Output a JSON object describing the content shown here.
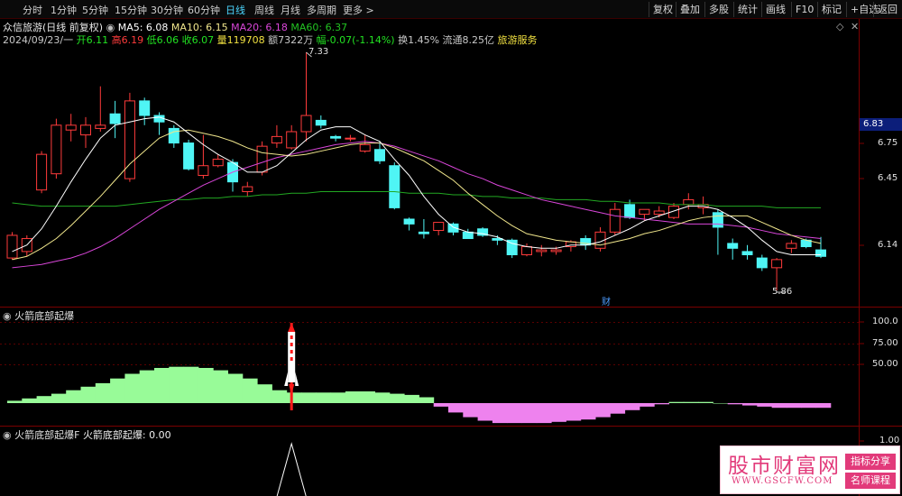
{
  "toolbar": {
    "tabs": [
      "分时",
      "1分钟",
      "5分钟",
      "15分钟",
      "30分钟",
      "60分钟",
      "日线",
      "周线",
      "月线",
      "多周期",
      "更多 >"
    ],
    "active_tab": "日线",
    "right_buttons": [
      "复权",
      "叠加",
      "多股",
      "统计",
      "画线",
      "F10",
      "标记",
      "+自选",
      "返回"
    ]
  },
  "header": {
    "stock_name": "众信旅游(日线 前复权)",
    "ma5": "MA5: 6.08",
    "ma10": "MA10: 6.15",
    "ma20": "MA20: 6.18",
    "ma60": "MA60: 6.37",
    "date": "2024/09/23/一",
    "open": "开6.11",
    "high": "高6.19",
    "low": "低6.06",
    "close": "收6.07",
    "volume": "量119708",
    "amount": "额7322万",
    "change": "幅-0.07(-1.14%)",
    "turnover": "换1.45%",
    "float_cap": "流通8.25亿",
    "sector": "旅游服务"
  },
  "price_axis": {
    "labels": [
      "6.75",
      "6.45",
      "6.14"
    ],
    "current_price": "6.83",
    "max_label": "7.33",
    "min_label": "5.86",
    "event_marker": "财"
  },
  "indicator1": {
    "title": "火箭底部起爆",
    "axis": [
      "100.0",
      "75.00",
      "50.00"
    ]
  },
  "indicator2": {
    "title": "火箭底部起爆F",
    "value_text": "火箭底部起爆: 0.00",
    "axis": [
      "1.00"
    ]
  },
  "watermark": {
    "title": "股市财富网",
    "url": "WWW.GSCFW.COM",
    "badge1": "指标分享",
    "badge2": "名师课程"
  },
  "colors": {
    "up": "#ff3b3b",
    "down": "#4ff5f5",
    "ma5": "#ffffff",
    "ma10": "#f0e68c",
    "ma20": "#d946d9",
    "ma60": "#22a822",
    "pos_area": "#98fb98",
    "neg_area": "#ee82ee"
  },
  "chart_data": {
    "type": "candlestick",
    "price_range": [
      5.86,
      7.33
    ],
    "candles": [
      {
        "o": 6.06,
        "h": 6.22,
        "l": 6.05,
        "c": 6.2
      },
      {
        "o": 6.1,
        "h": 6.2,
        "l": 6.07,
        "c": 6.18
      },
      {
        "o": 6.48,
        "h": 6.72,
        "l": 6.46,
        "c": 6.7
      },
      {
        "o": 6.58,
        "h": 6.92,
        "l": 6.55,
        "c": 6.88
      },
      {
        "o": 6.85,
        "h": 6.95,
        "l": 6.78,
        "c": 6.88
      },
      {
        "o": 6.82,
        "h": 6.93,
        "l": 6.74,
        "c": 6.88
      },
      {
        "o": 6.86,
        "h": 7.12,
        "l": 6.84,
        "c": 6.88
      },
      {
        "o": 6.95,
        "h": 7.03,
        "l": 6.8,
        "c": 6.89
      },
      {
        "o": 6.55,
        "h": 7.08,
        "l": 6.53,
        "c": 7.03
      },
      {
        "o": 7.03,
        "h": 7.05,
        "l": 6.88,
        "c": 6.94
      },
      {
        "o": 6.94,
        "h": 6.96,
        "l": 6.82,
        "c": 6.9
      },
      {
        "o": 6.86,
        "h": 6.88,
        "l": 6.74,
        "c": 6.77
      },
      {
        "o": 6.77,
        "h": 6.79,
        "l": 6.6,
        "c": 6.61
      },
      {
        "o": 6.57,
        "h": 6.82,
        "l": 6.55,
        "c": 6.63
      },
      {
        "o": 6.63,
        "h": 6.7,
        "l": 6.62,
        "c": 6.67
      },
      {
        "o": 6.65,
        "h": 6.67,
        "l": 6.47,
        "c": 6.53
      },
      {
        "o": 6.47,
        "h": 6.53,
        "l": 6.44,
        "c": 6.5
      },
      {
        "o": 6.59,
        "h": 6.78,
        "l": 6.57,
        "c": 6.75
      },
      {
        "o": 6.77,
        "h": 6.88,
        "l": 6.74,
        "c": 6.81
      },
      {
        "o": 6.74,
        "h": 6.88,
        "l": 6.73,
        "c": 6.84
      },
      {
        "o": 6.84,
        "h": 7.33,
        "l": 6.78,
        "c": 6.94
      },
      {
        "o": 6.91,
        "h": 6.94,
        "l": 6.86,
        "c": 6.88
      },
      {
        "o": 6.81,
        "h": 6.82,
        "l": 6.78,
        "c": 6.8
      },
      {
        "o": 6.8,
        "h": 6.82,
        "l": 6.78,
        "c": 6.8
      },
      {
        "o": 6.72,
        "h": 6.82,
        "l": 6.71,
        "c": 6.76
      },
      {
        "o": 6.73,
        "h": 6.78,
        "l": 6.64,
        "c": 6.66
      },
      {
        "o": 6.63,
        "h": 6.65,
        "l": 6.36,
        "c": 6.37
      },
      {
        "o": 6.3,
        "h": 6.31,
        "l": 6.23,
        "c": 6.27
      },
      {
        "o": 6.22,
        "h": 6.3,
        "l": 6.18,
        "c": 6.21
      },
      {
        "o": 6.23,
        "h": 6.28,
        "l": 6.2,
        "c": 6.28
      },
      {
        "o": 6.27,
        "h": 6.28,
        "l": 6.2,
        "c": 6.22
      },
      {
        "o": 6.22,
        "h": 6.24,
        "l": 6.18,
        "c": 6.18
      },
      {
        "o": 6.24,
        "h": 6.25,
        "l": 6.19,
        "c": 6.2
      },
      {
        "o": 6.18,
        "h": 6.2,
        "l": 6.14,
        "c": 6.17
      },
      {
        "o": 6.17,
        "h": 6.18,
        "l": 6.06,
        "c": 6.08
      },
      {
        "o": 6.08,
        "h": 6.15,
        "l": 6.07,
        "c": 6.13
      },
      {
        "o": 6.1,
        "h": 6.14,
        "l": 6.07,
        "c": 6.11
      },
      {
        "o": 6.1,
        "h": 6.13,
        "l": 6.08,
        "c": 6.11
      },
      {
        "o": 6.13,
        "h": 6.17,
        "l": 6.1,
        "c": 6.16
      },
      {
        "o": 6.18,
        "h": 6.2,
        "l": 6.11,
        "c": 6.14
      },
      {
        "o": 6.12,
        "h": 6.25,
        "l": 6.1,
        "c": 6.22
      },
      {
        "o": 6.22,
        "h": 6.4,
        "l": 6.2,
        "c": 6.36
      },
      {
        "o": 6.39,
        "h": 6.42,
        "l": 6.3,
        "c": 6.31
      },
      {
        "o": 6.33,
        "h": 6.36,
        "l": 6.29,
        "c": 6.36
      },
      {
        "o": 6.33,
        "h": 6.38,
        "l": 6.31,
        "c": 6.35
      },
      {
        "o": 6.31,
        "h": 6.4,
        "l": 6.3,
        "c": 6.38
      },
      {
        "o": 6.39,
        "h": 6.46,
        "l": 6.36,
        "c": 6.42
      },
      {
        "o": 6.37,
        "h": 6.44,
        "l": 6.33,
        "c": 6.39
      },
      {
        "o": 6.34,
        "h": 6.36,
        "l": 6.08,
        "c": 6.25
      },
      {
        "o": 6.15,
        "h": 6.18,
        "l": 6.05,
        "c": 6.12
      },
      {
        "o": 6.1,
        "h": 6.14,
        "l": 6.05,
        "c": 6.08
      },
      {
        "o": 6.06,
        "h": 6.08,
        "l": 5.98,
        "c": 6.0
      },
      {
        "o": 6.0,
        "h": 6.06,
        "l": 5.86,
        "c": 6.05
      },
      {
        "o": 6.12,
        "h": 6.17,
        "l": 6.09,
        "c": 6.15
      },
      {
        "o": 6.17,
        "h": 6.18,
        "l": 6.12,
        "c": 6.13
      },
      {
        "o": 6.11,
        "h": 6.19,
        "l": 6.06,
        "c": 6.07
      }
    ],
    "ma5": [
      6.1,
      6.14,
      6.24,
      6.38,
      6.53,
      6.67,
      6.8,
      6.88,
      6.9,
      6.92,
      6.93,
      6.9,
      6.83,
      6.76,
      6.7,
      6.65,
      6.59,
      6.59,
      6.63,
      6.71,
      6.79,
      6.85,
      6.87,
      6.87,
      6.82,
      6.78,
      6.67,
      6.57,
      6.44,
      6.33,
      6.25,
      6.22,
      6.21,
      6.19,
      6.15,
      6.13,
      6.12,
      6.12,
      6.14,
      6.14,
      6.16,
      6.2,
      6.24,
      6.29,
      6.32,
      6.35,
      6.38,
      6.38,
      6.36,
      6.31,
      6.25,
      6.17,
      6.1,
      6.08,
      6.08,
      6.08
    ],
    "ma10": [
      6.05,
      6.07,
      6.12,
      6.18,
      6.26,
      6.35,
      6.44,
      6.54,
      6.64,
      6.72,
      6.8,
      6.84,
      6.85,
      6.83,
      6.81,
      6.78,
      6.74,
      6.71,
      6.7,
      6.69,
      6.7,
      6.72,
      6.74,
      6.76,
      6.77,
      6.77,
      6.74,
      6.7,
      6.66,
      6.6,
      6.54,
      6.46,
      6.39,
      6.32,
      6.26,
      6.21,
      6.19,
      6.17,
      6.16,
      6.15,
      6.14,
      6.16,
      6.18,
      6.21,
      6.23,
      6.26,
      6.29,
      6.31,
      6.32,
      6.32,
      6.32,
      6.28,
      6.24,
      6.2,
      6.17,
      6.15
    ],
    "ma20": [
      6.0,
      6.01,
      6.02,
      6.04,
      6.06,
      6.09,
      6.13,
      6.18,
      6.24,
      6.3,
      6.36,
      6.41,
      6.46,
      6.51,
      6.55,
      6.59,
      6.62,
      6.65,
      6.68,
      6.7,
      6.72,
      6.74,
      6.76,
      6.77,
      6.78,
      6.77,
      6.75,
      6.72,
      6.69,
      6.66,
      6.62,
      6.58,
      6.55,
      6.51,
      6.48,
      6.45,
      6.42,
      6.4,
      6.38,
      6.36,
      6.34,
      6.32,
      6.31,
      6.3,
      6.29,
      6.28,
      6.27,
      6.27,
      6.27,
      6.26,
      6.25,
      6.23,
      6.21,
      6.2,
      6.19,
      6.18
    ],
    "ma60": [
      6.4,
      6.39,
      6.38,
      6.38,
      6.38,
      6.38,
      6.38,
      6.38,
      6.39,
      6.4,
      6.41,
      6.42,
      6.42,
      6.43,
      6.43,
      6.44,
      6.44,
      6.45,
      6.45,
      6.46,
      6.46,
      6.47,
      6.47,
      6.47,
      6.47,
      6.47,
      6.47,
      6.46,
      6.46,
      6.46,
      6.45,
      6.45,
      6.44,
      6.44,
      6.43,
      6.43,
      6.43,
      6.42,
      6.42,
      6.42,
      6.41,
      6.41,
      6.4,
      6.4,
      6.4,
      6.39,
      6.39,
      6.39,
      6.38,
      6.38,
      6.38,
      6.38,
      6.37,
      6.37,
      6.37,
      6.37
    ],
    "indicator_values": [
      2,
      4,
      6,
      8,
      11,
      14,
      17,
      21,
      25,
      28,
      30,
      31,
      31,
      30,
      28,
      25,
      21,
      16,
      11,
      9,
      9,
      9,
      9,
      10,
      10,
      9,
      8,
      7,
      5,
      -3,
      -8,
      -12,
      -15,
      -17,
      -17,
      -17,
      -17,
      -16,
      -15,
      -14,
      -12,
      -9,
      -6,
      -3,
      -1,
      1,
      1,
      1,
      0,
      -1,
      -2,
      -3,
      -4,
      -4,
      -4,
      -4
    ],
    "rocket_index": 19,
    "rocket_range": [
      0,
      100
    ]
  }
}
